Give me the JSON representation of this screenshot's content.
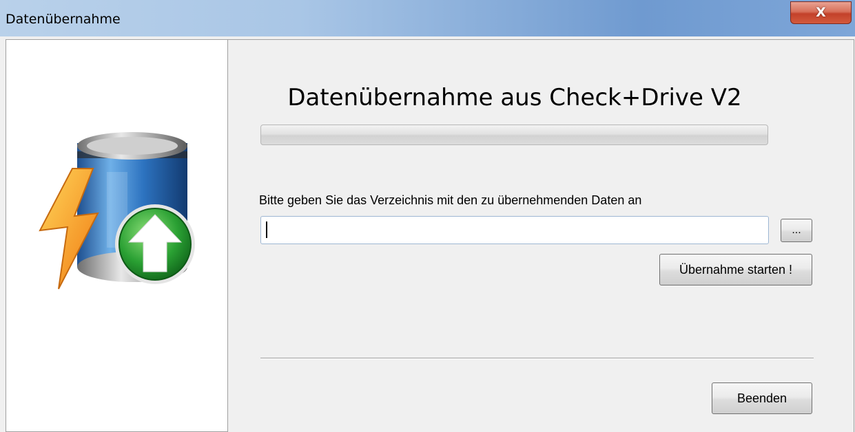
{
  "window": {
    "title": "Datenübernahme",
    "close_label": "X"
  },
  "main": {
    "heading": "Datenübernahme aus Check+Drive V2",
    "progress_percent": 0,
    "prompt": "Bitte geben Sie das Verzeichnis mit den zu übernehmenden Daten an",
    "directory_value": "",
    "browse_label": "...",
    "start_label": "Übernahme starten !",
    "quit_label": "Beenden"
  },
  "icons": {
    "app_icon": "database-import-icon",
    "lightning": "lightning-icon",
    "arrow": "up-arrow-icon"
  },
  "colors": {
    "titlebar": "#6f9ad0",
    "close_button": "#c3412a",
    "arrow_green": "#2aa033",
    "lightning_orange": "#f5a623"
  }
}
